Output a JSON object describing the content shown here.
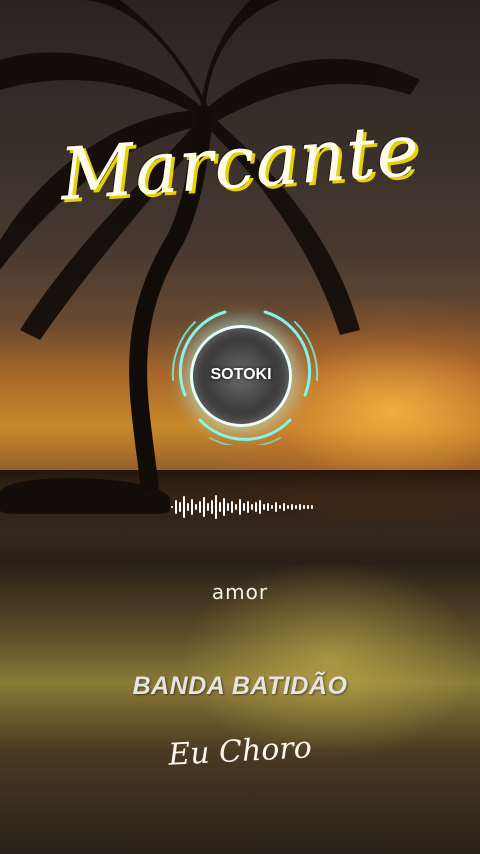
{
  "title_logo": "Marcante",
  "visualizer": {
    "center_logo": "SOTOKI",
    "ring_color": "#7ff3e6"
  },
  "song_word": "amor",
  "artist": "BANDA BATIDÃO",
  "track_title": "Eu Choro",
  "colors": {
    "logo_shadow": "#e6d200",
    "text": "#f4f0ea"
  }
}
